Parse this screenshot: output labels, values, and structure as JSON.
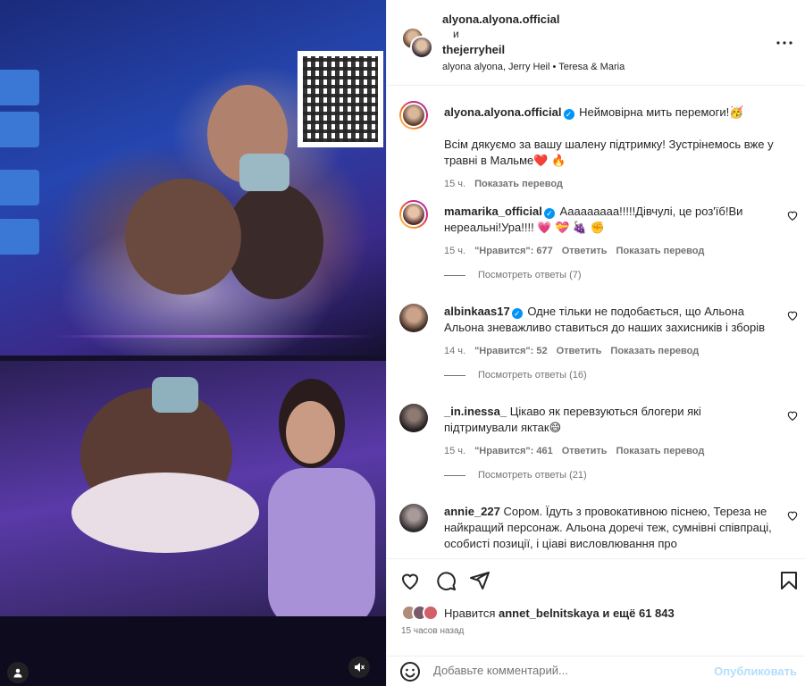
{
  "header": {
    "user1": "alyona.alyona.official",
    "conjunction": "и",
    "user2": "thejerryheil",
    "audio": "alyona alyona, Jerry Heil • Teresa & Maria"
  },
  "caption": {
    "user": "alyona.alyona.official",
    "line1": "Неймовірна мить перемоги!🥳",
    "line2": "Всім дякуємо за вашу шалену підтримку! Зустрінемось вже у травні в Мальме❤️ 🔥",
    "time": "15 ч.",
    "translate": "Показать перевод"
  },
  "comments": [
    {
      "user": "mamarika_official",
      "verified": true,
      "text": "Ааааааааа!!!!!Дівчулі, це роз'їб!Ви нереальні!Ура!!!! 💗 💝 🍇 ✊",
      "time": "15 ч.",
      "likes": "\"Нравится\": 677",
      "reply": "Ответить",
      "translate": "Показать перевод",
      "replies": "Посмотреть ответы (7)"
    },
    {
      "user": "albinkaas17",
      "verified": true,
      "text": "Одне тільки не подобається, що Альона Альона зневажливо ставиться до наших захисників і зборів",
      "time": "14 ч.",
      "likes": "\"Нравится\": 52",
      "reply": "Ответить",
      "translate": "Показать перевод",
      "replies": "Посмотреть ответы (16)"
    },
    {
      "user": "_in.inessa_",
      "verified": false,
      "text": "Цікаво як перевзуються блогери які підтримували яктак😄",
      "time": "15 ч.",
      "likes": "\"Нравится\": 461",
      "reply": "Ответить",
      "translate": "Показать перевод",
      "replies": "Посмотреть ответы (21)"
    },
    {
      "user": "annie_227",
      "verified": false,
      "text": "Сором. Їдуть з провокативною піснею, Тереза не найкращий персонаж. Альона доречі теж, сумнівні співпраці, особисті позиції, і ціаві висловлювання про"
    }
  ],
  "likes_line": {
    "prefix": "Нравится",
    "user": "annet_belnitskaya",
    "suffix": "и ещё 61 843"
  },
  "time_ago": "15 часов назад",
  "composer": {
    "placeholder": "Добавьте комментарий...",
    "publish": "Опубликовать"
  },
  "icons": {
    "more": "more-icon",
    "heart": "heart-icon",
    "comment": "comment-icon",
    "share": "share-icon",
    "save": "bookmark-icon",
    "emoji": "emoji-icon",
    "mute": "mute-icon",
    "user_tag": "user-tag-icon"
  },
  "colors": {
    "link_blue": "#0095f6",
    "publish_disabled": "#b2dffc",
    "secondary_text": "#737373"
  }
}
